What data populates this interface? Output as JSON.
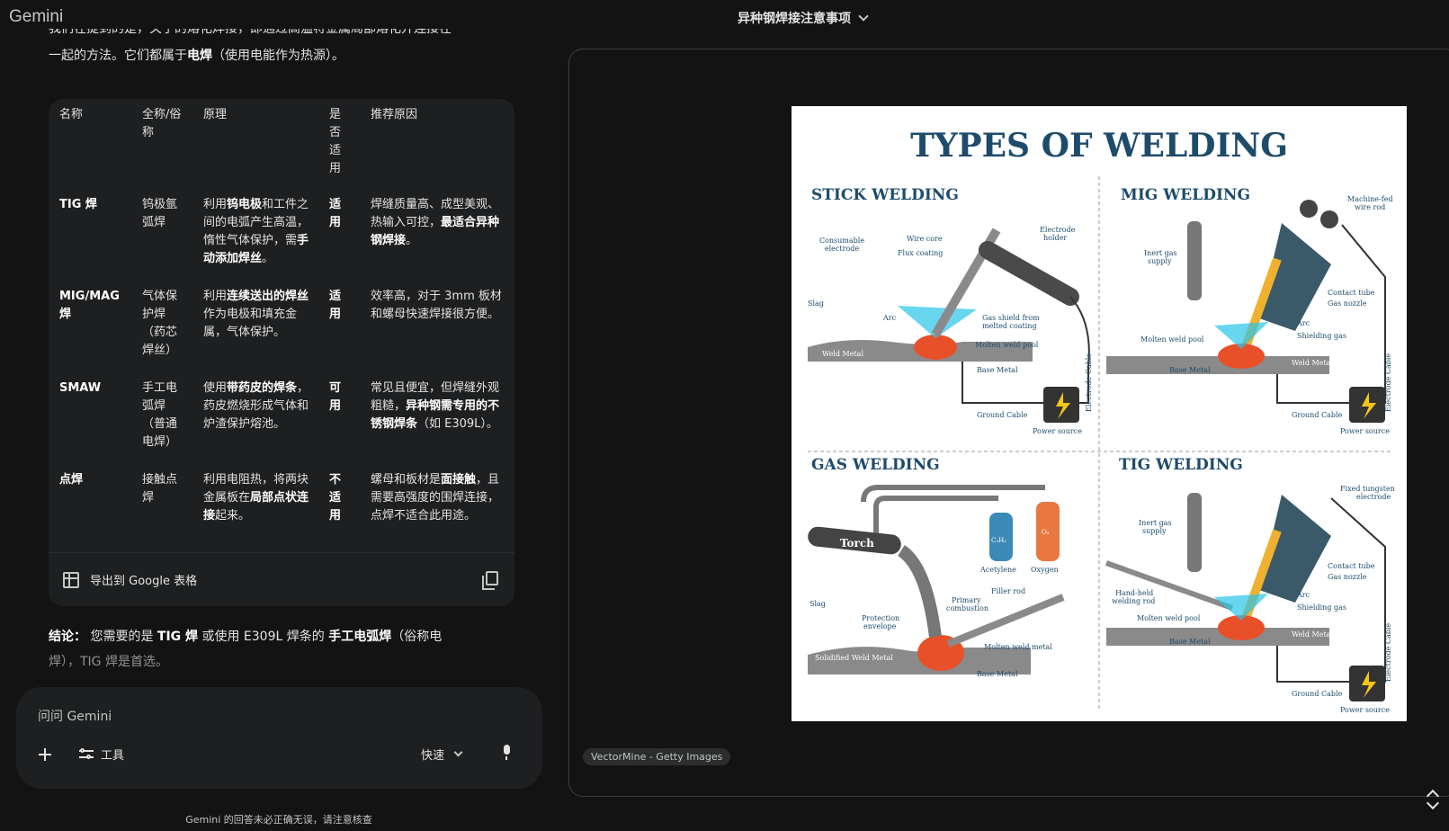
{
  "app": {
    "brand": "Gemini",
    "chat_title": "异种钢焊接注意事项"
  },
  "intro": {
    "line1_cut": "我们在提到的是，关于的熔化焊接，即通过高温将金属局部熔化并连接在",
    "line2_a": "一起的方法。它们都属于",
    "line2_b": "电焊",
    "line2_c": "（使用电能作为热源）。"
  },
  "table": {
    "headers": [
      "名称",
      "全称/俗称",
      "原理",
      "是否适用",
      "推荐原因"
    ],
    "rows": [
      {
        "name": "TIG 焊",
        "alias": "钨极氩弧焊",
        "p1": "利用",
        "p1b": "钨电极",
        "p1c": "和工件之间的电弧产生高温，惰性气体保护，需",
        "p1d": "手动添加焊丝",
        "p1e": "。",
        "suit": "适用",
        "r1": "焊缝质量高、成型美观、热输入可控，",
        "r1b": "最适合异种钢焊接",
        "r1c": "。"
      },
      {
        "name": "MIG/MAG 焊",
        "alias": "气体保护焊（药芯焊丝）",
        "p1": "利用",
        "p1b": "连续送出的焊丝",
        "p1c": "作为电极和填充金属，气体保护。",
        "p1d": "",
        "p1e": "",
        "suit": "适用",
        "r1": "效率高，对于 3mm 板材和螺母快速焊接很方便。",
        "r1b": "",
        "r1c": ""
      },
      {
        "name": "SMAW",
        "alias": "手工电弧焊（普通电焊）",
        "p1": "使用",
        "p1b": "带药皮的焊条",
        "p1c": "，药皮燃烧形成气体和炉渣保护熔池。",
        "p1d": "",
        "p1e": "",
        "suit": "可用",
        "r1": "常见且便宜，但焊缝外观粗糙，",
        "r1b": "异种钢需专用的不锈钢焊条",
        "r1c": "（如 E309L）。"
      },
      {
        "name": "点焊",
        "alias": "接触点焊",
        "p1": "利用电阻热，将两块金属板在",
        "p1b": "局部点状连接",
        "p1c": "起来。",
        "p1d": "",
        "p1e": "",
        "suit": "不适用",
        "r1": "螺母和板材是",
        "r1b": "面接触",
        "r1c": "，且需要高强度的围焊连接，点焊不适合此用途。"
      }
    ],
    "export_label": "导出到 Google 表格"
  },
  "conclusion": {
    "label": "结论：",
    "t1": "您需要的是 ",
    "b1": "TIG 焊",
    "t2": " 或使用 E309L 焊条的 ",
    "b2": "手工电弧焊",
    "t3": "（俗称电",
    "t4": "焊），TIG 焊是首选。"
  },
  "input": {
    "placeholder": "问问 Gemini",
    "tools": "工具",
    "mode": "快速"
  },
  "disclaimer": "Gemini 的回答未必正确无误，请注意核查",
  "viewer": {
    "credit": "VectorMine - Getty Images"
  },
  "poster": {
    "title": "TYPES OF WELDING",
    "stick": {
      "title": "STICK WELDING",
      "consumable": "Consumable",
      "electrode": "electrode",
      "wire_core": "Wire core",
      "flux": "Flux coating",
      "holder1": "Electrode",
      "holder2": "holder",
      "slag": "Slag",
      "arc": "Arc",
      "shield1": "Gas shield from",
      "shield2": "melted coating",
      "pool": "Molten weld pool",
      "weld_metal": "Weld Metal",
      "base": "Base Metal",
      "cable": "Electrode Cable",
      "ground": "Ground Cable",
      "power": "Power source"
    },
    "mig": {
      "title": "MIG WELDING",
      "feed1": "Machine-fed",
      "feed2": "wire rod",
      "gas1": "Inert gas",
      "gas2": "supply",
      "contact": "Contact tube",
      "nozzle": "Gas nozzle",
      "arc": "Arc",
      "shielding": "Shielding gas",
      "pool": "Molten weld pool",
      "weld_metal": "Weld Metal",
      "base": "Base Metal",
      "cable": "Electrode Cable",
      "ground": "Ground Cable",
      "power": "Power source"
    },
    "gas": {
      "title": "GAS WELDING",
      "torch": "Torch",
      "c2h2": "C₂H₂",
      "o2": "O₂",
      "acetylene": "Acetylene",
      "oxygen": "Oxygen",
      "filler": "Filler rod",
      "primary1": "Primary",
      "primary2": "combustion",
      "slag": "Slag",
      "prot1": "Protection",
      "prot2": "envelope",
      "molten": "Molten weld metal",
      "solid": "Solidified Weld Metal",
      "base": "Base Metal"
    },
    "tig": {
      "title": "TIG WELDING",
      "tung1": "Fixed tungsten",
      "tung2": "electrode",
      "gas1": "Inert gas",
      "gas2": "supply",
      "contact": "Contact tube",
      "nozzle": "Gas nozzle",
      "hand1": "Hand-held",
      "hand2": "welding rod",
      "arc": "Arc",
      "shielding": "Shielding gas",
      "pool": "Molten weld pool",
      "weld_metal": "Weld Metal",
      "base": "Base Metal",
      "cable": "Electrode Cable",
      "ground": "Ground Cable",
      "power": "Power source"
    }
  },
  "colors": {
    "title_blue": "#1d4b6b",
    "steel": "#8a8a8a",
    "flame": "#e8502a",
    "shield": "#29c4e8"
  }
}
